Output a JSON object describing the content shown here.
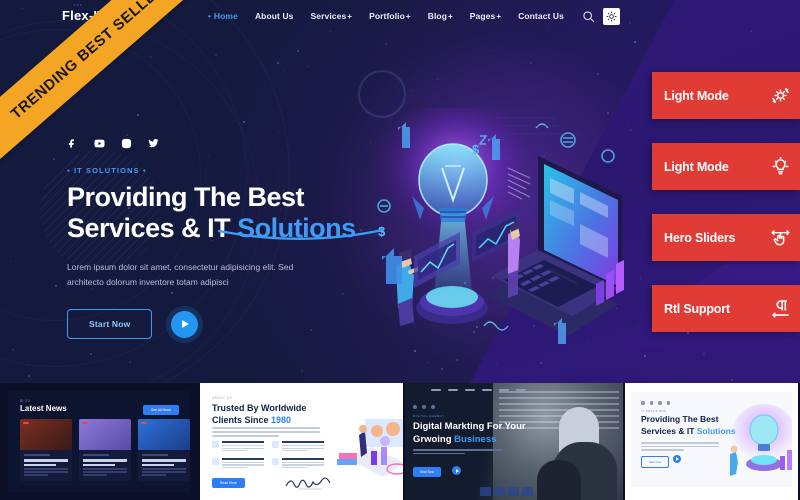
{
  "ribbon": {
    "text": "TRENDING BEST SELLER",
    "color": "#f5a524"
  },
  "header": {
    "logo": "Flex-IT",
    "logo_dots": "···",
    "nav": [
      {
        "label": "Home",
        "active": true,
        "dropdown": false
      },
      {
        "label": "About Us",
        "active": false,
        "dropdown": false
      },
      {
        "label": "Services",
        "active": false,
        "dropdown": true
      },
      {
        "label": "Portfolio",
        "active": false,
        "dropdown": true
      },
      {
        "label": "Blog",
        "active": false,
        "dropdown": true
      },
      {
        "label": "Pages",
        "active": false,
        "dropdown": true
      },
      {
        "label": "Contact Us",
        "active": false,
        "dropdown": false
      }
    ],
    "search_icon": "search-icon",
    "mode_icon": "brightness-sun-icon"
  },
  "hero": {
    "socials": [
      "facebook-icon",
      "youtube-icon",
      "instagram-icon",
      "twitter-icon"
    ],
    "eyebrow": "IT SOLUTIONS",
    "title_line1": "Providing The Best",
    "title_line2_plain": "Services & IT ",
    "title_line2_accent": "Solutions",
    "paragraph": "Lorem ipsum dolor sit amet, consectetur adipisicing elit. Sed architecto dolorum inventore totam adipisci",
    "cta_label": "Start Now",
    "play_icon": "play-icon",
    "accent_color": "#3f9bf5",
    "bg_color": "#151a3c",
    "wedge_color": "#31197a"
  },
  "features": {
    "color": "#e13b35",
    "items": [
      {
        "label": "Light Mode",
        "icon": "settings-gear-refresh-icon"
      },
      {
        "label": "Light Mode",
        "icon": "lightbulb-icon"
      },
      {
        "label": "Hero Sliders",
        "icon": "hand-drag-arrows-icon"
      },
      {
        "label": "Rtl Support",
        "icon": "pilcrow-rtl-arrow-icon"
      }
    ]
  },
  "thumbnails": [
    {
      "name": "latest-news",
      "eyebrow": "BLOG",
      "title": "Latest News",
      "button": "See All News",
      "cards": [
        {
          "tag": "Technology",
          "title": "How Unspared Technology Works To Speed Up Your Site"
        },
        {
          "tag": "Marketing",
          "title": "Give Your Website A New Look And Feel With Themes"
        },
        {
          "tag": "Business",
          "title": "The Role Of Dynamic Names In B2B Work Explained"
        }
      ]
    },
    {
      "name": "trusted-clients",
      "eyebrow": "ABOUT US",
      "title_line1": "Trusted By Worldwide",
      "title_line2_plain": "Clients Since ",
      "title_line2_accent": "1980",
      "features": [
        "Best On Field",
        "Easy To Reach",
        "Worldwide Services",
        "24/7 Support"
      ],
      "button": "Read More"
    },
    {
      "name": "digital-marketing",
      "eyebrow": "DIGITAL AGENCY",
      "title_line1": "Digital Markting For Your",
      "title_line2_plain": "Grwoing ",
      "title_line2_accent": "Business",
      "button": "Start Now"
    },
    {
      "name": "light-mode-hero",
      "eyebrow": "IT SOLUTIONS",
      "title_line1": "Providing The Best",
      "title_line2_plain": "Services & IT ",
      "title_line2_accent": "Solutions",
      "button": "Start Now"
    }
  ]
}
